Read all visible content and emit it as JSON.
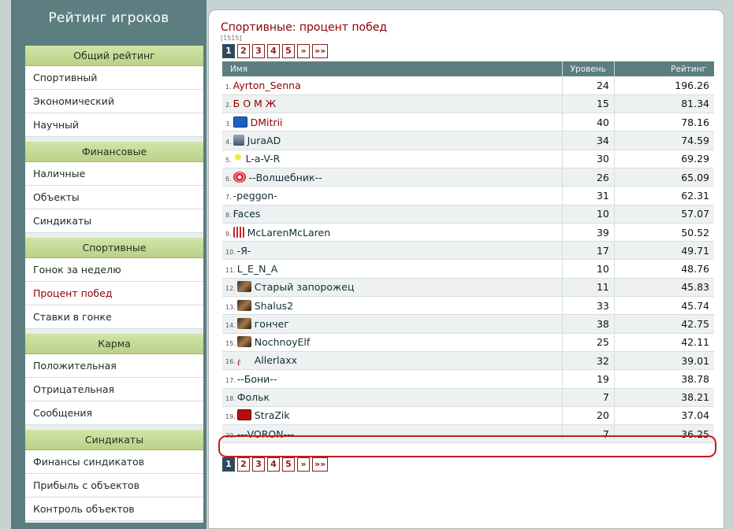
{
  "sidebar": {
    "title": "Рейтинг игроков",
    "groups": [
      {
        "heading": "Общий рейтинг",
        "items": [
          "Спортивный",
          "Экономический",
          "Научный"
        ]
      },
      {
        "heading": "Финансовые",
        "items": [
          "Наличные",
          "Объекты",
          "Синдикаты"
        ]
      },
      {
        "heading": "Спортивные",
        "items": [
          "Гонок за неделю",
          "Процент побед",
          "Ставки в гонке"
        ]
      },
      {
        "heading": "Карма",
        "items": [
          "Положительная",
          "Отрицательная",
          "Сообщения"
        ]
      },
      {
        "heading": "Синдикаты",
        "items": [
          "Финансы синдикатов",
          "Прибыль с объектов",
          "Контроль объектов"
        ]
      }
    ],
    "active_item": "Процент побед"
  },
  "main": {
    "title": "Спортивные: процент побед",
    "total": "[1515]",
    "pager": [
      "1",
      "2",
      "3",
      "4",
      "5",
      "»",
      "»»"
    ],
    "current_page": "1",
    "table": {
      "headers": [
        "Имя",
        "Уровень",
        "Рейтинг"
      ],
      "rows": [
        {
          "rank": "1.",
          "name": "Ayrton_Senna",
          "level": "24",
          "rating": "196.26",
          "icon": "none",
          "red": true
        },
        {
          "rank": "2.",
          "name": "Б О М Ж",
          "level": "15",
          "rating": "81.34",
          "icon": "none",
          "red": true
        },
        {
          "rank": "3.",
          "name": "DMitrii",
          "level": "40",
          "rating": "78.16",
          "icon": "blue-logo-icon",
          "red": true
        },
        {
          "rank": "4.",
          "name": "JuraAD",
          "level": "34",
          "rating": "74.59",
          "icon": "badge-icon",
          "red": false
        },
        {
          "rank": "5.",
          "name": "L-a-V-R",
          "level": "30",
          "rating": "69.29",
          "icon": "bulb-icon",
          "red": false
        },
        {
          "rank": "6.",
          "name": "--Волшебник--",
          "level": "26",
          "rating": "65.09",
          "icon": "swirl-icon",
          "red": false
        },
        {
          "rank": "7.",
          "name": "-peggon-",
          "level": "31",
          "rating": "62.31",
          "icon": "none",
          "red": false
        },
        {
          "rank": "8.",
          "name": "Faces",
          "level": "10",
          "rating": "57.07",
          "icon": "none",
          "red": false
        },
        {
          "rank": "9.",
          "name": "McLarenMcLaren",
          "level": "39",
          "rating": "50.52",
          "icon": "stripes-icon",
          "red": false
        },
        {
          "rank": "10.",
          "name": "-Я-",
          "level": "17",
          "rating": "49.71",
          "icon": "none",
          "red": false
        },
        {
          "rank": "11.",
          "name": "L_E_N_A",
          "level": "10",
          "rating": "48.76",
          "icon": "none",
          "red": false
        },
        {
          "rank": "12.",
          "name": "Старый запорожец",
          "level": "11",
          "rating": "45.83",
          "icon": "photo-icon",
          "red": false
        },
        {
          "rank": "13.",
          "name": "Shalus2",
          "level": "33",
          "rating": "45.74",
          "icon": "photo-icon",
          "red": false
        },
        {
          "rank": "14.",
          "name": "гончег",
          "level": "38",
          "rating": "42.75",
          "icon": "photo-icon",
          "red": false
        },
        {
          "rank": "15.",
          "name": "NochnoyElf",
          "level": "25",
          "rating": "42.11",
          "icon": "photo-icon",
          "red": false
        },
        {
          "rank": "16.",
          "name": "Allerlaxx",
          "level": "32",
          "rating": "39.01",
          "icon": "text-logo-icon",
          "red": false
        },
        {
          "rank": "17.",
          "name": "--Бони--",
          "level": "19",
          "rating": "38.78",
          "icon": "none",
          "red": false
        },
        {
          "rank": "18.",
          "name": "Фольк",
          "level": "7",
          "rating": "38.21",
          "icon": "none",
          "red": false
        },
        {
          "rank": "19.",
          "name": "StraZik",
          "level": "20",
          "rating": "37.04",
          "icon": "red-logo-icon",
          "red": false
        },
        {
          "rank": "20.",
          "name": "---VORON---",
          "level": "7",
          "rating": "36.25",
          "icon": "none",
          "red": false
        }
      ]
    }
  },
  "colors": {
    "sidebar_bg": "#5d7e80",
    "group_header": "#c6dc97",
    "accent_red": "#8b0000",
    "highlight_ring": "#c41e1e"
  }
}
